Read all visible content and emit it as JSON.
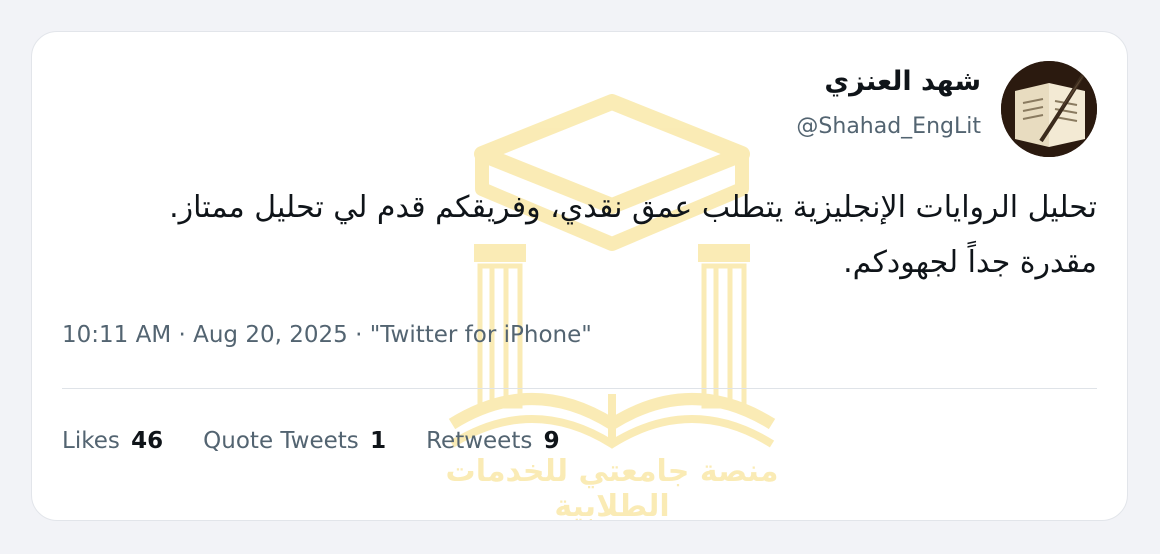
{
  "tweet": {
    "author_name": "شهد العنزي",
    "author_handle": "@Shahad_EngLit",
    "text_line1": "تحليل الروايات الإنجليزية يتطلب عمق نقدي، وفريقكم قدم لي تحليل ممتاز.",
    "text_line2": "مقدرة جداً لجهودكم.",
    "time": "10:11 AM",
    "date": "Aug 20, 2025",
    "source": "\"Twitter for iPhone\"",
    "separator": "·"
  },
  "stats": {
    "likes_label": "Likes",
    "likes_count": "46",
    "quotes_label": "Quote Tweets",
    "quotes_count": "1",
    "retweets_label": "Retweets",
    "retweets_count": "9"
  },
  "watermark": {
    "text": "منصة جامعتي للخدمات الطلابية"
  },
  "colors": {
    "watermark_gold": "#f0c31c",
    "text_primary": "#0f1419",
    "text_secondary": "#536471"
  }
}
